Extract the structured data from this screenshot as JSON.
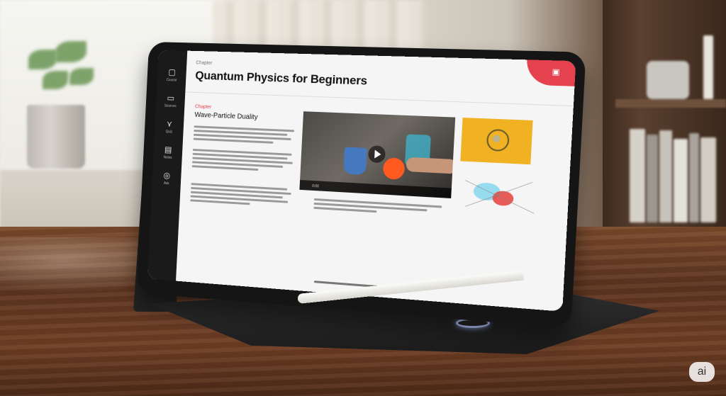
{
  "app": {
    "breadcrumb": "Chapter",
    "title": "Quantum Physics for Beginners",
    "accent_color": "#e5414f"
  },
  "sidebar": {
    "items": [
      {
        "icon": "document-icon",
        "label": "Course"
      },
      {
        "icon": "folder-icon",
        "label": "Sources"
      },
      {
        "icon": "graph-icon",
        "label": "Quiz"
      },
      {
        "icon": "notes-icon",
        "label": "Notes"
      },
      {
        "icon": "help-icon",
        "label": "Ask"
      }
    ]
  },
  "chapter": {
    "kicker": "Chapter",
    "title": "Wave-Particle Duality"
  },
  "video": {
    "time": "0:00"
  },
  "watermark": "ai"
}
